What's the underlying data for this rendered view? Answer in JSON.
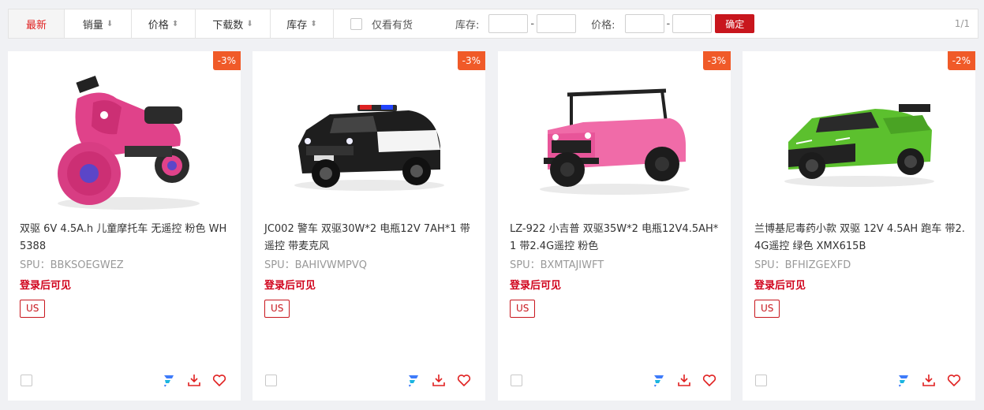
{
  "filters": {
    "tabs": [
      {
        "label": "最新",
        "arrow": ""
      },
      {
        "label": "销量",
        "arrow": "⬇"
      },
      {
        "label": "价格",
        "arrow": "⬍"
      },
      {
        "label": "下载数",
        "arrow": "⬇"
      },
      {
        "label": "库存",
        "arrow": "⬍"
      }
    ],
    "in_stock_label": "仅看有货",
    "stock_label": "库存:",
    "price_label": "价格:",
    "dash": "-",
    "confirm_label": "确定",
    "page_indicator": "1/1"
  },
  "colors": {
    "accent_red": "#c8161d",
    "discount_orange": "#f05a28",
    "price_red": "#d0021b"
  },
  "products": [
    {
      "discount": "-3%",
      "title": "双驱 6V 4.5A.h 儿童摩托车 无遥控 粉色 WH5388",
      "spu": "SPU：BBKSOEGWEZ",
      "price_text": "登录后可见",
      "region": "US",
      "image": "pink-kids-motorcycle"
    },
    {
      "discount": "-3%",
      "title": "JC002 警车 双驱30W*2 电瓶12V 7AH*1 带遥控 带麦克风",
      "spu": "SPU：BAHIVWMPVQ",
      "price_text": "登录后可见",
      "region": "US",
      "image": "black-police-suv"
    },
    {
      "discount": "-3%",
      "title": "LZ-922 小吉普 双驱35W*2 电瓶12V4.5AH*1 带2.4G遥控 粉色",
      "spu": "SPU：BXMTAJIWFT",
      "price_text": "登录后可见",
      "region": "US",
      "image": "pink-jeep"
    },
    {
      "discount": "-2%",
      "title": "兰博基尼毒药小款 双驱 12V 4.5AH 跑车 带2.4G遥控 绿色 XMX615B",
      "spu": "SPU：BFHIZGEXFD",
      "price_text": "登录后可见",
      "region": "US",
      "image": "green-sports-car"
    }
  ]
}
